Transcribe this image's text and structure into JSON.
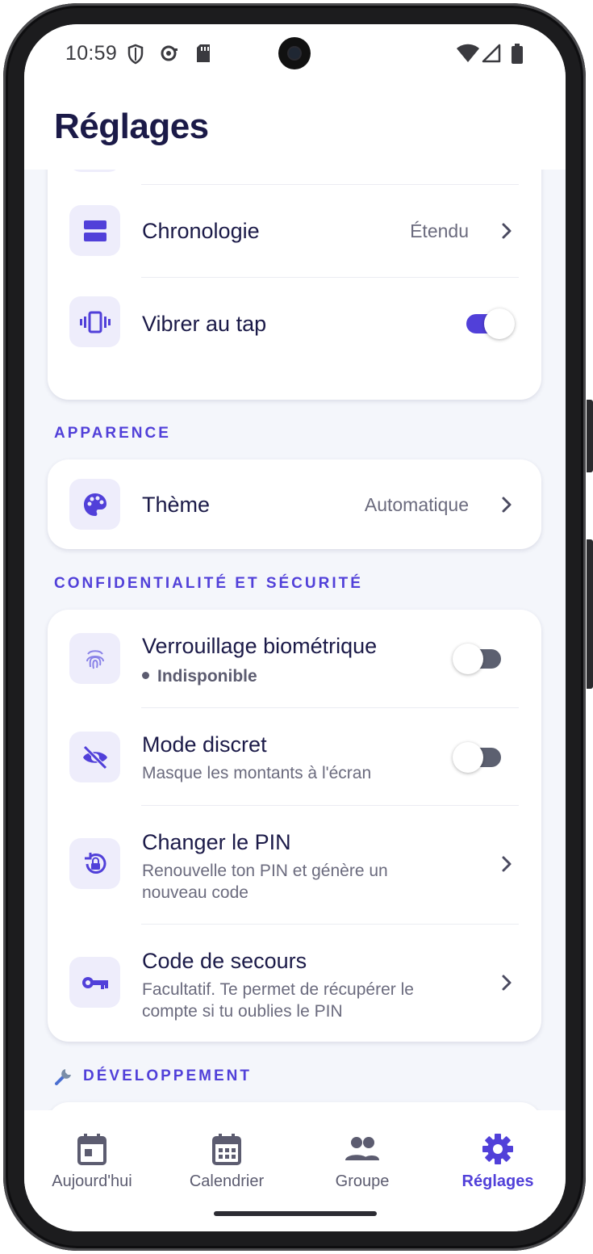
{
  "status_bar": {
    "time": "10:59"
  },
  "header": {
    "title": "Réglages"
  },
  "general_card": {
    "items": [
      {
        "label": "Chronologie",
        "value": "Étendu",
        "icon": "timeline-icon"
      },
      {
        "label": "Vibrer au tap",
        "icon": "vibrate-icon",
        "toggle": true
      }
    ]
  },
  "appearance": {
    "section_label": "APPARENCE",
    "items": [
      {
        "label": "Thème",
        "value": "Automatique",
        "icon": "palette-icon"
      }
    ]
  },
  "privacy": {
    "section_label": "CONFIDENTIALITÉ ET SÉCURITÉ",
    "items": [
      {
        "label": "Verrouillage biométrique",
        "status": "Indisponible",
        "icon": "fingerprint-icon",
        "toggle": false
      },
      {
        "label": "Mode discret",
        "subtitle": "Masque les montants à l'écran",
        "icon": "eye-off-icon",
        "toggle": false
      },
      {
        "label": "Changer le PIN",
        "subtitle": "Renouvelle ton PIN et génère un nouveau code",
        "icon": "lock-reset-icon"
      },
      {
        "label": "Code de secours",
        "subtitle": "Facultatif. Te permet de récupérer le compte si tu oublies le PIN",
        "icon": "key-icon"
      }
    ]
  },
  "development": {
    "section_label": "DÉVELOPPEMENT",
    "icon": "wrench-icon"
  },
  "bottom_nav": {
    "items": [
      {
        "label": "Aujourd'hui",
        "icon": "calendar-today-icon"
      },
      {
        "label": "Calendrier",
        "icon": "calendar-month-icon"
      },
      {
        "label": "Groupe",
        "icon": "group-icon"
      },
      {
        "label": "Réglages",
        "icon": "gear-icon",
        "active": true
      }
    ]
  },
  "colors": {
    "accent": "#5140d9",
    "title": "#1b1a48",
    "muted": "#6b6b7e",
    "icon_bg": "#eeedfb",
    "background": "#f4f6fb"
  }
}
